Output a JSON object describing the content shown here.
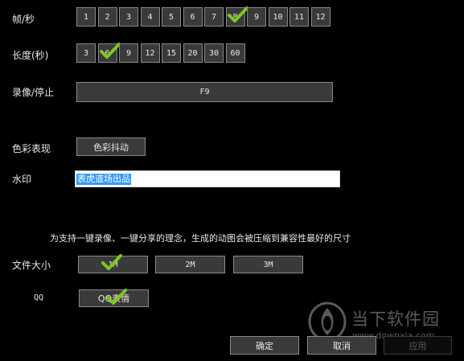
{
  "fps": {
    "label": "帧/秒",
    "options": [
      "1",
      "2",
      "3",
      "4",
      "5",
      "6",
      "7",
      "8",
      "9",
      "10",
      "11",
      "12"
    ],
    "selected": "8"
  },
  "duration": {
    "label": "长度(秒)",
    "options": [
      "3",
      "6",
      "9",
      "12",
      "15",
      "20",
      "30",
      "60"
    ],
    "selected": "6"
  },
  "record": {
    "label": "录像/停止",
    "hotkey": "F9"
  },
  "color": {
    "label": "色彩表现",
    "button": "色彩抖动"
  },
  "watermark": {
    "label": "水印",
    "value": "表虎道场出品"
  },
  "info_text": "为支持一键录像、一键分享的理念，生成的动图会被压缩到兼容性最好的尺寸",
  "filesize": {
    "label": "文件大小",
    "options": [
      "1M",
      "2M",
      "3M"
    ],
    "selected": "1M"
  },
  "qq": {
    "label": "QQ",
    "button": "QQ表情"
  },
  "footer": {
    "ok": "确定",
    "cancel": "取消",
    "apply": "应用"
  },
  "brand": {
    "name": "当下软件园",
    "url": "www.downxia.com"
  },
  "colors": {
    "check": "#7ec81e",
    "button_bg": "#3a3a3a",
    "highlight": "#3399ff"
  }
}
